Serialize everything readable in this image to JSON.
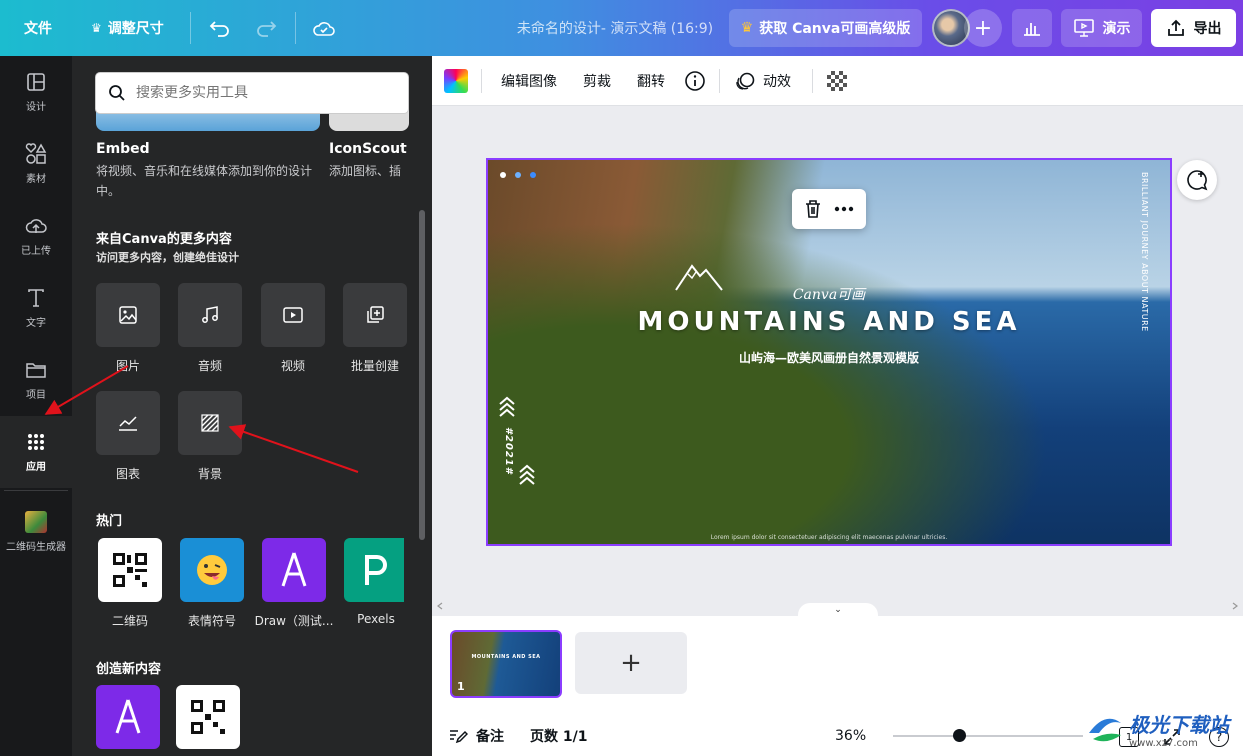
{
  "topbar": {
    "file": "文件",
    "resize": "调整尺寸",
    "title": "未命名的设计- 演示文稿 (16:9)",
    "upgrade": "获取 Canva可画高级版",
    "present": "演示",
    "export": "导出"
  },
  "rail": {
    "items": [
      {
        "label": "设计",
        "icon": "layout-icon"
      },
      {
        "label": "素材",
        "icon": "shapes-icon"
      },
      {
        "label": "已上传",
        "icon": "cloud-upload-icon"
      },
      {
        "label": "文字",
        "icon": "text-icon"
      },
      {
        "label": "项目",
        "icon": "folder-icon"
      },
      {
        "label": "应用",
        "icon": "apps-grid-icon"
      },
      {
        "label": "二维码生成器",
        "icon": "qr-app-icon"
      }
    ],
    "active": "应用"
  },
  "panel": {
    "search_placeholder": "搜索更多实用工具",
    "top_apps": [
      {
        "name": "Embed",
        "desc_line1": "将视频、音乐和在线媒体添加到你的设计",
        "desc_line2": "中。"
      },
      {
        "name": "IconScout",
        "desc_line1": "添加图标、插"
      }
    ],
    "more_section": {
      "title": "来自Canva的更多内容",
      "subtitle": "访问更多内容，创建绝佳设计",
      "tiles": [
        {
          "label": "图片",
          "icon": "image-icon"
        },
        {
          "label": "音频",
          "icon": "music-icon"
        },
        {
          "label": "视频",
          "icon": "video-icon"
        },
        {
          "label": "批量创建",
          "icon": "bulk-create-icon"
        },
        {
          "label": "图表",
          "icon": "chart-icon"
        },
        {
          "label": "背景",
          "icon": "background-pattern-icon"
        }
      ]
    },
    "popular": {
      "title": "热门",
      "apps": [
        {
          "label": "二维码",
          "icon": "qr-code-icon",
          "color": "#ffffff"
        },
        {
          "label": "表情符号",
          "icon": "emoji-icon",
          "color": "#1a8fd6"
        },
        {
          "label": "Draw（测试...",
          "icon": "draw-icon",
          "color": "#7d2ae8"
        },
        {
          "label": "Pexels",
          "icon": "pexels-icon",
          "color": "#05a081"
        }
      ]
    },
    "create": {
      "title": "创造新内容"
    }
  },
  "toolbar": {
    "edit_image": "编辑图像",
    "crop": "剪裁",
    "flip": "翻转",
    "animate": "动效"
  },
  "slide": {
    "logo_text": "Canva可画",
    "title": "MOUNTAINS AND SEA",
    "subtitle": "山屿海—欧美风画册自然景观模版",
    "vertical_text": "BRILLIANT JOURNEY ABOUT NATURE",
    "year": "#2021#",
    "footer": "Lorem ipsum dolor sit consectetuer adipiscing elit maecenas pulvinar ultricies."
  },
  "pages": {
    "thumb_title": "MOUNTAINS AND SEA",
    "page_number": "1",
    "add": "+"
  },
  "footer": {
    "notes": "备注",
    "pages": "页数 1/1",
    "zoom": "36%",
    "page_count_box": "1",
    "help": "?"
  },
  "watermark": {
    "text": "极光下载站",
    "url": "www.xz7.com"
  },
  "colors": {
    "accent": "#8b3dff",
    "rail_bg": "#18191b",
    "panel_bg": "#252627",
    "annotation_arrow": "#e0121b"
  }
}
